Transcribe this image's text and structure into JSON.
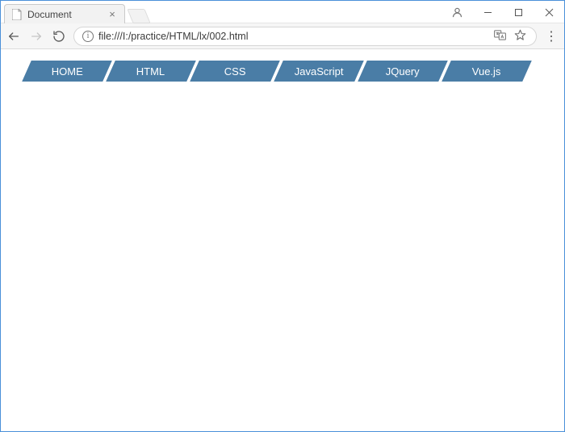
{
  "browser": {
    "tab_title": "Document",
    "url": "file:///I:/practice/HTML/lx/002.html"
  },
  "nav": {
    "items": [
      {
        "label": "HOME"
      },
      {
        "label": "HTML"
      },
      {
        "label": "CSS"
      },
      {
        "label": "JavaScript"
      },
      {
        "label": "JQuery"
      },
      {
        "label": "Vue.js"
      }
    ]
  },
  "colors": {
    "nav_bg": "#4a7da6"
  }
}
